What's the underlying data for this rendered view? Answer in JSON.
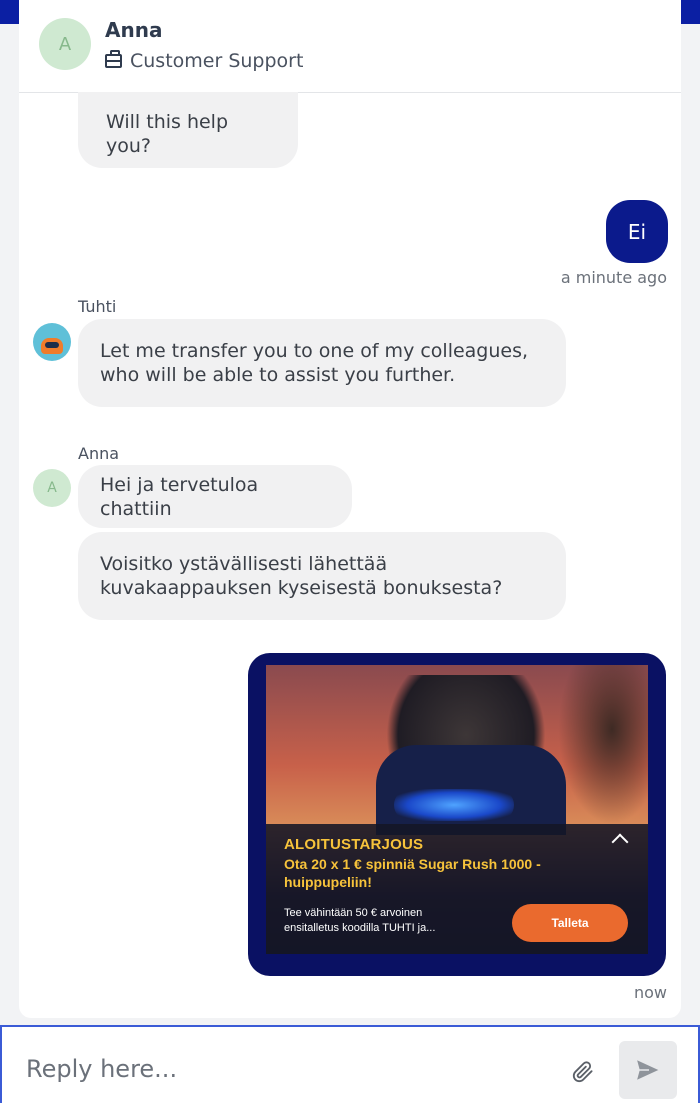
{
  "header": {
    "avatar_initial": "A",
    "agent_name": "Anna",
    "agent_role": "Customer Support"
  },
  "messages": {
    "help": "Will this help you?",
    "outgoing": "Ei",
    "outgoing_time": "a minute ago",
    "tuhti_sender": "Tuhti",
    "tuhti_text": "Let me transfer you to one of my colleagues, who will be able to assist you further.",
    "anna_sender": "Anna",
    "anna_initial": "A",
    "anna_greeting": "Hei ja tervetuloa chattiin",
    "anna_request": "Voisitko ystävällisesti lähettää kuvakaappauksen kyseisestä bonuksesta?",
    "ad_time": "now"
  },
  "ad": {
    "title": "ALOITUSTARJOUS",
    "subtitle": "Ota 20 x 1 € spinniä Sugar Rush 1000 - huippupeliin!",
    "description": "Tee vähintään 50 € arvoinen ensitalletus koodilla TUHTI ja...",
    "cta": "Talleta"
  },
  "reply": {
    "placeholder": "Reply here..."
  },
  "colors": {
    "brand_blue": "#0b1a8c",
    "accent_orange": "#ea6a2e",
    "ad_gold": "#f7c33b"
  }
}
